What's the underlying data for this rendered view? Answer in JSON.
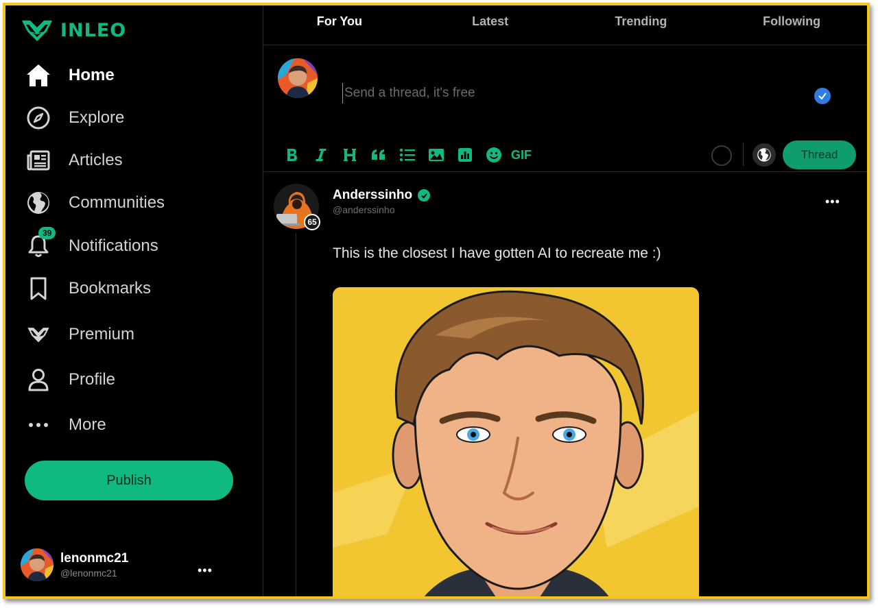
{
  "app": {
    "brand": "INLEO",
    "accent": "#10b981",
    "frame_color": "#f5c518"
  },
  "sidebar": {
    "items": [
      {
        "label": "Home",
        "icon": "home-icon",
        "active": true
      },
      {
        "label": "Explore",
        "icon": "compass-icon"
      },
      {
        "label": "Articles",
        "icon": "newspaper-icon"
      },
      {
        "label": "Communities",
        "icon": "globe-icon"
      },
      {
        "label": "Notifications",
        "icon": "bell-icon",
        "badge": "39"
      },
      {
        "label": "Bookmarks",
        "icon": "bookmark-icon"
      },
      {
        "label": "Premium",
        "icon": "leo-logo-icon"
      },
      {
        "label": "Profile",
        "icon": "user-icon"
      },
      {
        "label": "More",
        "icon": "more-dots-icon"
      }
    ],
    "publish_label": "Publish",
    "account": {
      "username": "lenonmc21",
      "handle": "@lenonmc21",
      "more": "•••"
    }
  },
  "tabs": [
    {
      "label": "For You",
      "active": true
    },
    {
      "label": "Latest"
    },
    {
      "label": "Trending"
    },
    {
      "label": "Following"
    }
  ],
  "composer": {
    "placeholder": "Send a thread, it's free",
    "tools": [
      "bold-icon",
      "italic-icon",
      "heading-icon",
      "quote-icon",
      "list-icon",
      "image-icon",
      "poll-chart-icon",
      "emoji-icon"
    ],
    "gif_label": "GIF",
    "submit_label": "Thread"
  },
  "post": {
    "author": "Anderssinho",
    "handle": "@anderssinho",
    "reputation": "65",
    "more": "•••",
    "text": "This is the closest I have gotten AI to recreate me :)"
  }
}
